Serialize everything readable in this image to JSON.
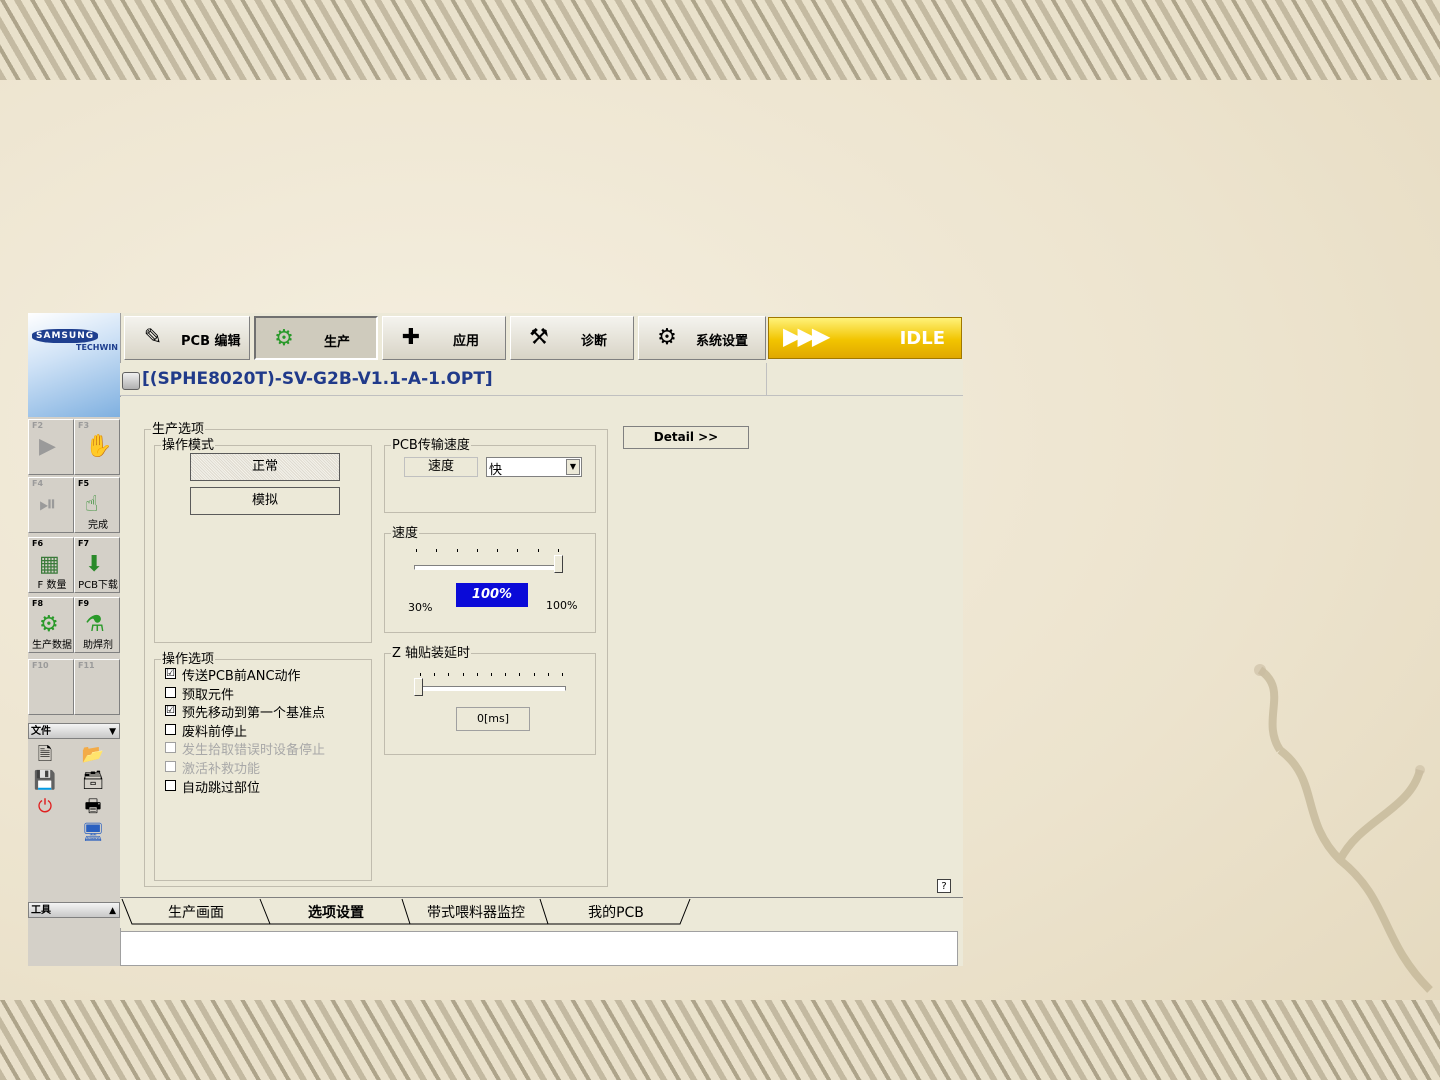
{
  "toolbar": {
    "items": [
      {
        "label": "PCB 编辑",
        "icon": "pcb-edit-icon"
      },
      {
        "label": "生产",
        "icon": "production-gear-icon"
      },
      {
        "label": "应用",
        "icon": "application-icon"
      },
      {
        "label": "诊断",
        "icon": "diagnosis-icon"
      },
      {
        "label": "系统设置",
        "icon": "system-settings-icon"
      }
    ],
    "status": "IDLE"
  },
  "logo": {
    "brand": "SAMSUNG",
    "sub": "TECHWIN"
  },
  "file_title": "[(SPHE8020T)-SV-G2B-V1.1-A-1.OPT]",
  "sidebar": {
    "fkeys": [
      {
        "key": "F2",
        "label": "",
        "icon": "play-icon"
      },
      {
        "key": "F3",
        "label": "",
        "icon": "hand-stop-icon"
      },
      {
        "key": "F4",
        "label": "",
        "icon": "step-play-icon"
      },
      {
        "key": "F5",
        "label": "完成",
        "icon": "finish-hand-icon"
      },
      {
        "key": "F6",
        "label": "F 数量",
        "icon": "grid-count-icon"
      },
      {
        "key": "F7",
        "label": "PCB下载",
        "icon": "pcb-download-icon"
      },
      {
        "key": "F8",
        "label": "生产数据",
        "icon": "production-data-icon"
      },
      {
        "key": "F9",
        "label": "助焊剂",
        "icon": "flux-icon"
      },
      {
        "key": "F10",
        "label": "",
        "icon": ""
      },
      {
        "key": "F11",
        "label": "",
        "icon": ""
      }
    ],
    "file_section": "文件",
    "tools_section": "工具"
  },
  "production_options": {
    "title": "生产选项",
    "operation_mode": {
      "title": "操作模式",
      "normal": "正常",
      "simulate": "模拟"
    },
    "pcb_speed": {
      "title": "PCB传输速度",
      "speed_label": "速度",
      "speed_value": "快"
    },
    "speed": {
      "title": "速度",
      "min": "30%",
      "current": "100%",
      "max": "100%",
      "level_percent": 100
    },
    "z_delay": {
      "title": "Z 轴贴装延时",
      "value": "0[ms]",
      "level_percent": 0
    },
    "operation_options": {
      "title": "操作选项",
      "items": [
        {
          "label": "传送PCB前ANC动作",
          "checked": "☑"
        },
        {
          "label": "预取元件",
          "checked": ""
        },
        {
          "label": "预先移动到第一个基准点",
          "checked": "☑"
        },
        {
          "label": "废料前停止",
          "checked": ""
        },
        {
          "label": "发生拾取错误时设备停止",
          "checked": ""
        },
        {
          "label": "激活补救功能",
          "checked": ""
        },
        {
          "label": "自动跳过部位",
          "checked": ""
        }
      ]
    }
  },
  "detail_button": "Detail >>",
  "help": "?",
  "tabs": [
    {
      "label": "生产画面"
    },
    {
      "label": "选项设置"
    },
    {
      "label": "带式喂料器监控"
    },
    {
      "label": "我的PCB"
    }
  ],
  "colors": {
    "accent_blue": "#0a0ad8",
    "status_yellow": "#f2c400",
    "title_blue": "#203a8a"
  }
}
